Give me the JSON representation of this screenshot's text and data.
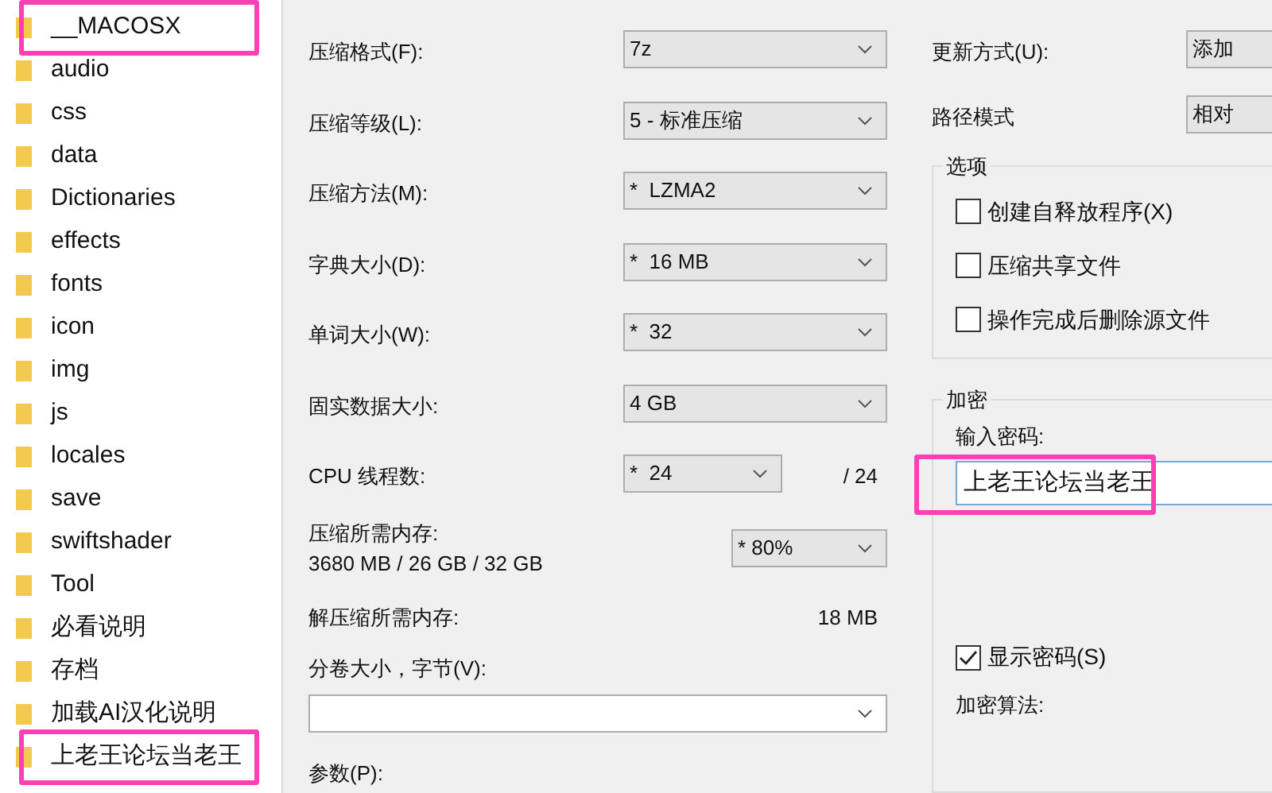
{
  "folders": [
    {
      "name": "__MACOSX",
      "highlighted": true
    },
    {
      "name": "audio",
      "highlighted": false
    },
    {
      "name": "css",
      "highlighted": false
    },
    {
      "name": "data",
      "highlighted": false
    },
    {
      "name": "Dictionaries",
      "highlighted": false
    },
    {
      "name": "effects",
      "highlighted": false
    },
    {
      "name": "fonts",
      "highlighted": false
    },
    {
      "name": "icon",
      "highlighted": false
    },
    {
      "name": "img",
      "highlighted": false
    },
    {
      "name": "js",
      "highlighted": false
    },
    {
      "name": "locales",
      "highlighted": false
    },
    {
      "name": "save",
      "highlighted": false
    },
    {
      "name": "swiftshader",
      "highlighted": false
    },
    {
      "name": "Tool",
      "highlighted": false
    },
    {
      "name": "必看说明",
      "highlighted": false
    },
    {
      "name": "存档",
      "highlighted": false
    },
    {
      "name": "加载AI汉化说明",
      "highlighted": false
    },
    {
      "name": "上老王论坛当老王",
      "highlighted": true
    }
  ],
  "settings": [
    {
      "label": "压缩格式(F):",
      "value": "7z"
    },
    {
      "label": "压缩等级(L):",
      "value": "5 - 标准压缩"
    },
    {
      "label": "压缩方法(M):",
      "value": "*  LZMA2"
    },
    {
      "label": "字典大小(D):",
      "value": "*  16 MB"
    },
    {
      "label": "单词大小(W):",
      "value": "*  32"
    },
    {
      "label": "固实数据大小:",
      "value": "4 GB"
    }
  ],
  "threads": {
    "label": "CPU 线程数:",
    "value": "*  24",
    "max": "/ 24"
  },
  "memory": {
    "label": "压缩所需内存:",
    "reading": "3680 MB / 26 GB / 32 GB",
    "value": "* 80%"
  },
  "decompress_memory": {
    "label": "解压缩所需内存:",
    "reading": "18 MB"
  },
  "volume": {
    "label": "分卷大小，字节(V):"
  },
  "parameters": {
    "label": "参数(P):"
  },
  "update_mode": {
    "label": "更新方式(U):",
    "value": "添加"
  },
  "path_mode": {
    "label": "路径模式",
    "value": "相对"
  },
  "options": {
    "title": "选项",
    "items": [
      {
        "label": "创建自释放程序(X)",
        "checked": false
      },
      {
        "label": "压缩共享文件",
        "checked": false
      },
      {
        "label": "操作完成后删除源文件",
        "checked": false
      }
    ]
  },
  "encryption": {
    "title": "加密",
    "password_label": "输入密码:",
    "password": "上老王论坛当老王",
    "password_highlighted": true,
    "show_password": {
      "label": "显示密码(S)",
      "checked": true
    },
    "method_label": "加密算法:"
  }
}
